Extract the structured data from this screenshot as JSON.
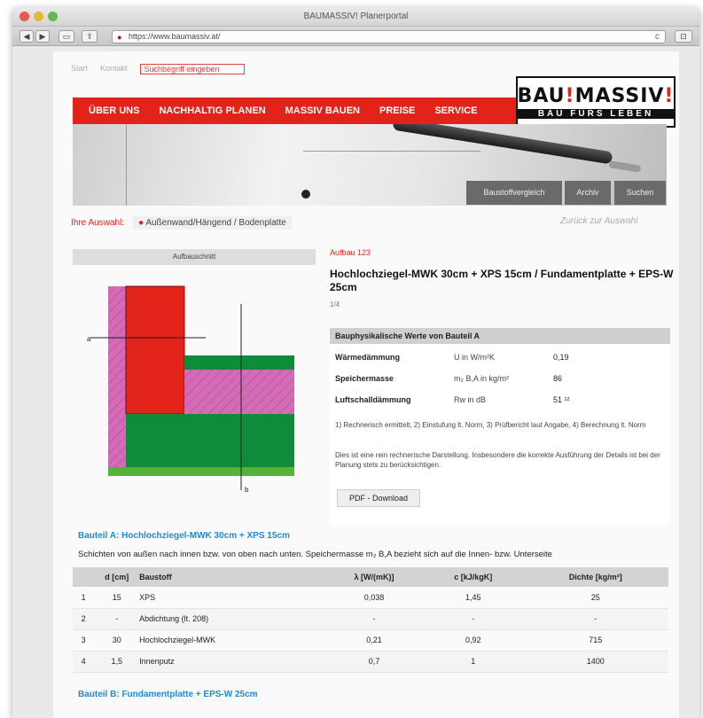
{
  "browser": {
    "title": "BAUMASSIV! Planerportal",
    "url": "https://www.baumassiv.at/",
    "back": "◀",
    "forward": "▶",
    "reader": "▭",
    "share": "⇪",
    "reload": "c",
    "sidebar": "⊡"
  },
  "page": {
    "top_links": [
      "Start",
      "Kontakt"
    ],
    "search_placeholder": "Suchbegriff eingeben",
    "nav": [
      "ÜBER UNS",
      "NACHHALTIG PLANEN",
      "MASSIV BAUEN",
      "PREISE",
      "SERVICE"
    ],
    "logo": {
      "part1": "BAU",
      "mark": "!",
      "part2": "MASSIV",
      "part3": "!",
      "tagline": "BAU FÜRS LEBEN"
    },
    "hero_buttons": [
      "Baustoffvergleich",
      "Archiv",
      "Suchen"
    ],
    "breadcrumb": {
      "first": "Ihre Auswahl:",
      "second_mark": "●",
      "second": "Außenwand/Hängend / Bodenplatte"
    },
    "back_link": "Zurück zur Auswahl",
    "diagram_heading": "Aufbauschnitt",
    "diagram_labels": {
      "a": "a",
      "b": "b"
    },
    "subheading": "Aufbau 123",
    "product_title": "Hochlochziegel-MWK 30cm + XPS 15cm / Fundamentplatte + EPS-W 25cm",
    "product_sub": "1/4",
    "values": {
      "heading": "Bauphysikalische Werte von Bauteil A",
      "rows": [
        {
          "label": "Wärmedämmung",
          "unit": "U in W/m²K",
          "value": "0,19"
        },
        {
          "label": "Speichermasse",
          "unit": "m₂ B,A in kg/m²",
          "value": "86"
        },
        {
          "label": "Luftschalldämmung",
          "unit": "Rw in dB",
          "value": "51 ¹²"
        }
      ],
      "footnote1": "1) Rechnerisch ermittelt, 2) Einstufung lt. Norm, 3) Prüfbericht laut Angabe, 4) Berechnung lt. Norm",
      "footnote2": "Dies ist eine rein rechnerische Darstellung. Insbesondere die korrekte Ausführung der Details ist bei der Planung stets zu berücksichtigen.",
      "pdf_button": "PDF - Download"
    },
    "section_a_title": "Bauteil A: Hochlochziegel-MWK 30cm + XPS 15cm",
    "section_a_desc": "Schichten von außen nach innen bzw. von oben nach unten. Speichermasse m₂ B,A bezieht sich auf die Innen- bzw. Unterseite",
    "table": {
      "headers": [
        "",
        "d [cm]",
        "Baustoff",
        "λ [W/(mK)]",
        "c [kJ/kgK]",
        "Dichte [kg/m³]"
      ],
      "rows": [
        [
          "1",
          "15",
          "XPS",
          "0,038",
          "1,45",
          "25"
        ],
        [
          "2",
          "-",
          "Abdichtung (lt. 208)",
          "-",
          "-",
          "-"
        ],
        [
          "3",
          "30",
          "Hochlochziegel-MWK",
          "0,21",
          "0,92",
          "715"
        ],
        [
          "4",
          "1,5",
          "Innenputz",
          "0,7",
          "1",
          "1400"
        ]
      ]
    },
    "section_b_title": "Bauteil B: Fundamentplatte + EPS-W 25cm"
  },
  "colors": {
    "brand_red": "#e2231a",
    "link_blue": "#1f8bd0",
    "layer_red": "#e2231a",
    "layer_pink": "#d46bb7",
    "layer_green": "#0f8c3a",
    "layer_lightgreen": "#56b33a"
  }
}
